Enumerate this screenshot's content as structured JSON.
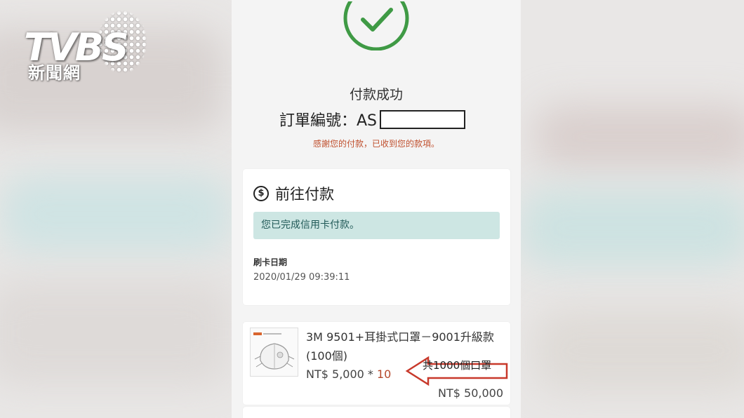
{
  "logo": {
    "brand": "TVBS",
    "subtitle": "新聞網"
  },
  "status": {
    "title": "付款成功",
    "order_label": "訂單編號：AS",
    "thanks": "感謝您的付款，已收到您的款項。"
  },
  "payment_card": {
    "heading": "前往付款",
    "icon": "dollar-circle-icon",
    "notice": "您已完成信用卡付款。",
    "date_label": "刷卡日期",
    "date_value": "2020/01/29 09:39:11"
  },
  "item": {
    "title": "3M 9501+耳掛式口罩－9001升級款(100個)",
    "unit_price": "NT$ 5,000 * ",
    "quantity": "10",
    "subtotal": "NT$ 50,000",
    "annotation": "共1000個口罩"
  },
  "colors": {
    "success_green": "#3f9a45",
    "annotation_red": "#c8392b",
    "notice_bg": "#cde6e3",
    "thanks_text": "#c0502e"
  }
}
